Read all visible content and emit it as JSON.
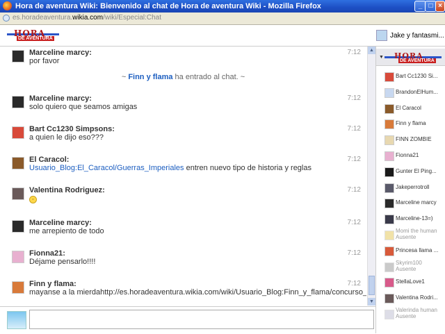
{
  "window": {
    "title": "Hora de aventura Wiki: Bienvenido al chat de Hora de aventura Wiki - Mozilla Firefox",
    "url_prefix": "es.horadeaventura.",
    "url_domain": "wikia.com",
    "url_path": "/wiki/Especial:Chat"
  },
  "header": {
    "logo_line1": "HORA",
    "logo_line2": "DE AVENTURA",
    "room_name": "Jake y fantasmi..."
  },
  "messages": [
    {
      "user": "Marceline marcy:",
      "text": "por favor",
      "time": "7:12",
      "avatar_color": "#2a2a2a"
    },
    {
      "user": "Marceline marcy:",
      "text": "solo quiero que seamos amigas",
      "time": "7:12",
      "avatar_color": "#2a2a2a"
    },
    {
      "user": "Bart Cc1230 Simpsons:",
      "text": "a quien le dijo eso???",
      "time": "7:12",
      "avatar_color": "#d84a3a"
    },
    {
      "user": "El Caracol:",
      "link": "Usuario_Blog:El_Caracol/Guerras_Imperiales",
      "text": " entren nuevo tipo de historia y reglas",
      "time": "7:12",
      "avatar_color": "#8a5a2a"
    },
    {
      "user": "Valentina Rodriguez:",
      "emoji": "smiley-face",
      "time": "7:12",
      "avatar_color": "#6a5a5a"
    },
    {
      "user": "Marceline marcy:",
      "text": "me arrepiento de todo",
      "time": "7:12",
      "avatar_color": "#2a2a2a"
    },
    {
      "user": "Fionna21:",
      "text": "Déjame pensarlo!!!!",
      "time": "7:12",
      "avatar_color": "#e8b0d0"
    },
    {
      "user": "Finn y flama:",
      "text": "mayanse a la mierdahttp://es.horadeaventura.wikia.com/wiki/Usuario_Blog:Finn_y_flama/concurso_tu_en_hora_de_aventura",
      "time": "7:12",
      "avatar_color": "#d87a3a"
    }
  ],
  "inline_notice": {
    "prefix": "~ ",
    "user": "Finn y flama",
    "text": " ha entrado al chat. ~"
  },
  "users": [
    {
      "name": "Bart Cc1230 Si...",
      "color": "#d84a3a"
    },
    {
      "name": "BrandonElHum...",
      "color": "#c8d8f0"
    },
    {
      "name": "El Caracol",
      "color": "#8a5a2a"
    },
    {
      "name": "Finn y flama",
      "color": "#d87a3a"
    },
    {
      "name": "FINN ZOMBIE",
      "color": "#e8d8b0"
    },
    {
      "name": "Fionna21",
      "color": "#e8b0d0"
    },
    {
      "name": "Gunter El Ping...",
      "color": "#1a1a1a"
    },
    {
      "name": "Jakeperrotroll",
      "color": "#5a5a6a"
    },
    {
      "name": "Marceline marcy",
      "color": "#2a2a2a"
    },
    {
      "name": "Marceline-13=)",
      "color": "#3a3a4a"
    },
    {
      "name": "Momi the human",
      "status": "Ausente",
      "color": "#e8d070"
    },
    {
      "name": "Princesa llama ...",
      "color": "#d85a3a"
    },
    {
      "name": "Skyrim100",
      "status": "Ausente",
      "color": "#a8a8a8"
    },
    {
      "name": "StellaLove1",
      "color": "#d85a8a"
    },
    {
      "name": "Valentina Rodri...",
      "color": "#6a5a5a"
    },
    {
      "name": "Valerinda human",
      "status": "Ausente",
      "color": "#c8c8d8"
    }
  ],
  "colors": {
    "link": "#1c5ec0",
    "titlebar": "#1d4fc4"
  }
}
